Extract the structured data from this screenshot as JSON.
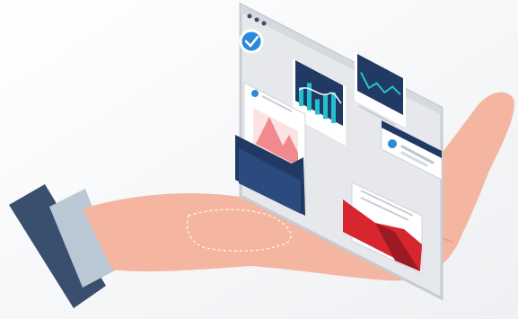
{
  "colors": {
    "background": "#f4f5f7",
    "skin": "#f4b6a1",
    "skin_shadow": "#e89e87",
    "sleeve_dark": "#3a4e6e",
    "cuff_light": "#b9c8d4",
    "window_bg": "#e6e8eb",
    "window_border": "#c8ccd2",
    "navy": "#213a64",
    "teal": "#25c0cf",
    "check_blue": "#2f89d9",
    "folder_red": "#d8262e",
    "folder_red_dark": "#9c1b22",
    "card_white": "#ffffff"
  },
  "icons": [
    "window-dots-icon",
    "checkmark-badge-icon",
    "bar-chart-card-icon",
    "line-chart-card-icon",
    "profile-card-icon",
    "image-document-icon",
    "blue-folder-icon",
    "red-folder-icon"
  ],
  "chart_bars": [
    0.55,
    0.8,
    0.45,
    0.7,
    0.9
  ],
  "line_points": [
    0.3,
    0.75,
    0.4,
    0.6,
    0.2,
    0.35
  ]
}
